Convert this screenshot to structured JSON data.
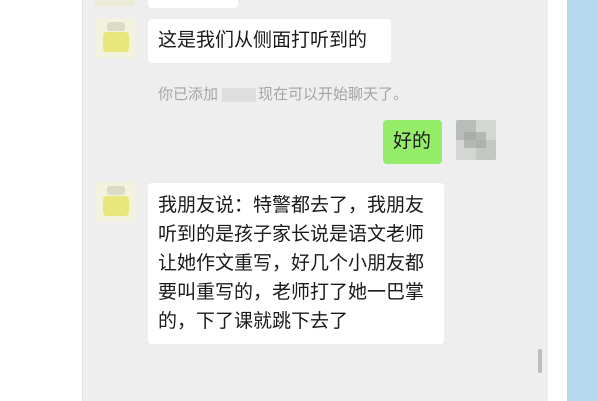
{
  "messages": [
    {
      "sender": "contact",
      "text": "这是我们从侧面打听到的"
    },
    {
      "sender": "self",
      "text": "好的"
    },
    {
      "sender": "contact",
      "lines": [
        "我朋友说：特警都去了，我朋友",
        "听到的是孩子家长说是语文老师",
        "让她作文重写，好几个小朋友都",
        "要叫重写的，老师打了她一巴掌",
        "的，下了课就跳下去了"
      ]
    }
  ],
  "system_notice": {
    "prefix": "你已添加",
    "suffix": "现在可以开始聊天了。"
  },
  "colors": {
    "chat_bg": "#eeeeee",
    "incoming_bubble": "#ffffff",
    "outgoing_bubble": "#95ec69",
    "notice_text": "#a4a4a4",
    "side_panel": "#b7d7ec"
  }
}
